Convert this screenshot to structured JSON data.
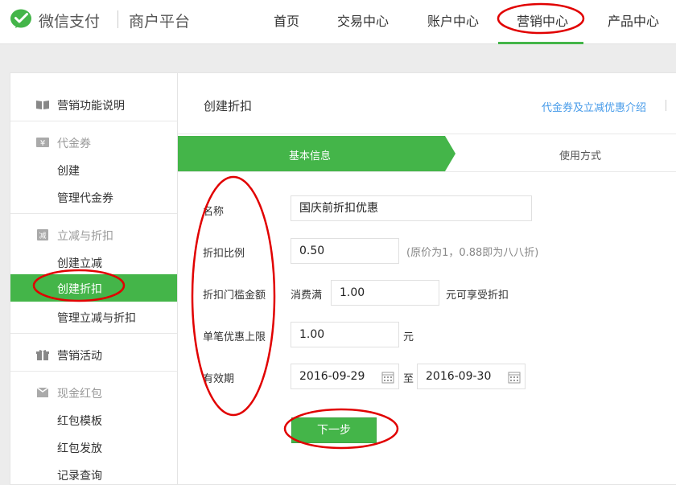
{
  "header": {
    "brand": "微信支付",
    "platform": "商户平台",
    "nav": [
      {
        "label": "首页"
      },
      {
        "label": "交易中心"
      },
      {
        "label": "账户中心"
      },
      {
        "label": "营销中心",
        "active": true
      },
      {
        "label": "产品中心"
      }
    ]
  },
  "sidebar": {
    "intro": "营销功能说明",
    "voucher": {
      "title": "代金券",
      "items": [
        "创建",
        "管理代金券"
      ]
    },
    "discount": {
      "title": "立减与折扣",
      "items": [
        "创建立减",
        "创建折扣",
        "管理立减与折扣"
      ],
      "active_index": 1
    },
    "activity": "营销活动",
    "redpacket": {
      "title": "现金红包",
      "items": [
        "红包模板",
        "红包发放",
        "记录查询"
      ]
    }
  },
  "main": {
    "title": "创建折扣",
    "intro_link": "代金券及立减优惠介绍",
    "steps": [
      "基本信息",
      "使用方式"
    ],
    "form": {
      "name_label": "名称",
      "name_value": "国庆前折扣优惠",
      "ratio_label": "折扣比例",
      "ratio_value": "0.50",
      "ratio_hint": "(原价为1，0.88即为八八折)",
      "threshold_label": "折扣门槛金额",
      "threshold_prefix": "消费满",
      "threshold_value": "1.00",
      "threshold_suffix": "元可享受折扣",
      "cap_label": "单笔优惠上限",
      "cap_value": "1.00",
      "cap_unit": "元",
      "validity_label": "有效期",
      "date_start": "2016-09-29",
      "date_to": "至",
      "date_end": "2016-09-30"
    },
    "next_button": "下一步"
  },
  "colors": {
    "accent": "#44b549",
    "link": "#459ae9",
    "annotation": "#e10000"
  }
}
